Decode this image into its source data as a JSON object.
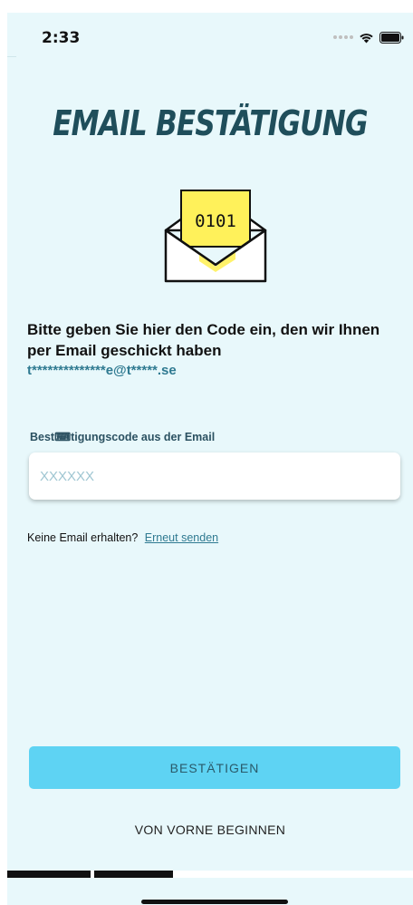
{
  "status_bar": {
    "time": "2:33"
  },
  "header": {
    "title": "EMAIL BESTÄTIGUNG"
  },
  "illustration": {
    "code_text": "0101",
    "icon": "envelope-with-code-icon"
  },
  "instruction": {
    "text": "Bitte geben Sie hier den Code ein, den wir Ihnen per Email geschickt haben",
    "masked_email": "t**************e@t*****.se"
  },
  "form": {
    "code_label": "Best⌨tigungscode aus der Email",
    "code_placeholder": "XXXXXX",
    "code_value": ""
  },
  "resend": {
    "prompt": "Keine Email erhalten?",
    "link_label": "Erneut senden"
  },
  "actions": {
    "confirm_label": "BESTÄTIGEN",
    "restart_label": "VON VORNE BEGINNEN"
  },
  "colors": {
    "background": "#e8f8fb",
    "accent": "#5ed3f3",
    "title": "#1f4e5b",
    "link": "#2f7a91",
    "envelope_letter": "#fff15a"
  }
}
